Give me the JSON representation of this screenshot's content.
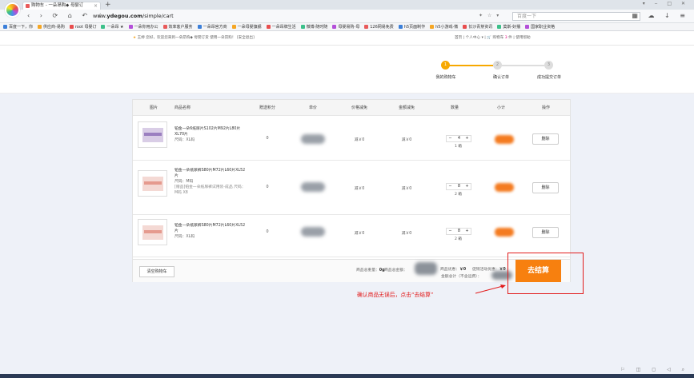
{
  "browser": {
    "tab_title": "购物车 - 一朵昂购◆ 母婴订",
    "url_prefix": "www.",
    "url_host": "ydegou.com",
    "url_path": "/simple/cart",
    "search_placeholder": "百度一下"
  },
  "bookmarks": [
    "百度一下，你",
    "供应商-易购",
    "root 母婴订",
    "一朵昂 ★",
    "一朵你用办公",
    "效率客户服务",
    "一朵昂官方商",
    "一朵母婴旗舰",
    "一朵昂牌生活",
    "微博-随时随",
    "母婴易购-母",
    "126网易免费",
    "h5页面制作",
    "h5小游戏-微",
    "长沙青芽资讯",
    "莫斯-好播",
    "国家职业资格"
  ],
  "site_header": {
    "welcome": "王婷 您好，欢迎您来到一朵昂购◆ 母婴订货 使用一朵昂购！",
    "logout": "[安全退出]",
    "home": "首页",
    "personal": "个人中心",
    "cart_label": "购物车",
    "cart_count": "3",
    "cart_unit": "件",
    "help": "使用帮助"
  },
  "steps": [
    {
      "num": "1",
      "label": "我的购物车",
      "active": true
    },
    {
      "num": "2",
      "label": "确认订单",
      "active": false
    },
    {
      "num": "3",
      "label": "成功提交订单",
      "active": false
    }
  ],
  "table_headers": [
    "图片",
    "商品名称",
    "赠送积分",
    "单价",
    "价格减免",
    "金额减免",
    "数量",
    "小计",
    "操作"
  ],
  "items": [
    {
      "name": "铂金一朵6纸尿片S102片M92片L80片XL70片",
      "size": "尺码：XL码",
      "gift": "",
      "points": "0",
      "price_cut": "减￥0",
      "amount_cut": "减￥0",
      "qty": "4",
      "qty_unit": "1 箱",
      "delete": "删除"
    },
    {
      "name": "铂金一朵纸尿裤S80片M72片L60片XL52片",
      "size": "尺码：M码",
      "gift": "[赠品]铂金一朵纸尿裤试用装-成品 尺码：M码 X8",
      "points": "0",
      "price_cut": "减￥0",
      "amount_cut": "减￥0",
      "qty": "8",
      "qty_unit": "2 箱",
      "delete": "删除"
    },
    {
      "name": "铂金一朵纸尿裤S80片M72片L60片XL52片",
      "size": "尺码：XL码",
      "gift": "",
      "points": "0",
      "price_cut": "减￥0",
      "amount_cut": "减￥0",
      "qty": "8",
      "qty_unit": "2 箱",
      "delete": "删除"
    }
  ],
  "footer": {
    "clear_cart": "清空购物车",
    "total_weight_label": "商品总重量：",
    "total_weight": "0g",
    "total_amount_label": "商品总金额：",
    "discount_label": "商品优惠：",
    "discount": "￥0",
    "promo_label": "促销活动优惠：",
    "promo": "￥0",
    "grand_total_label": "金额总计（不含运费）："
  },
  "checkout_label": "去结算",
  "annotation": "确认商品无误后，点击“去结算”",
  "colors": {
    "accent": "#f7800f",
    "step_active": "#f7a800",
    "annotation": "#e21c1c"
  }
}
